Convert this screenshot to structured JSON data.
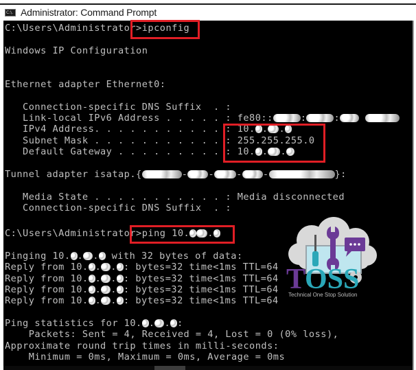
{
  "window": {
    "title": "Administrator: Command Prompt",
    "icon": "cmd-icon",
    "icon_text": "C:\\."
  },
  "console": {
    "lines": {
      "l01": {
        "prefix": "C:\\Users\\Administrator>",
        "command": "ipconfig"
      },
      "l02": "Windows IP Configuration",
      "l03": "Ethernet adapter Ethernet0:",
      "l04": "   Connection-specific DNS Suffix  . :",
      "l05": {
        "label": "   Link-local IPv6 Address . . . . . : ",
        "value": "fe80::",
        "redacted": true
      },
      "l06": {
        "label": "   IPv4 Address. . . . . . . . . . . : ",
        "value": "10.",
        "redacted": true
      },
      "l07": {
        "label": "   Subnet Mask . . . . . . . . . . . : ",
        "value": "255.255.255.0"
      },
      "l08": {
        "label": "   Default Gateway . . . . . . . . . : ",
        "value": "10.",
        "redacted": true
      },
      "l09": {
        "prefix": "Tunnel adapter isatap.{",
        "suffix": "}:",
        "redacted": true
      },
      "l10": {
        "label": "   Media State . . . . . . . . . . . : ",
        "value": "Media disconnected"
      },
      "l11": "   Connection-specific DNS Suffix  . :",
      "l12": {
        "prefix": "C:\\Users\\Administrator>",
        "command": "ping 10.",
        "redacted": true
      },
      "l13": {
        "prefix": "Pinging 10.",
        "suffix": " with 32 bytes of data:",
        "redacted": true
      },
      "replies": [
        {
          "prefix": "Reply from 10.",
          "suffix": ": bytes=32 time<1ms TTL=64"
        },
        {
          "prefix": "Reply from 10.",
          "suffix": ": bytes=32 time<1ms TTL=64"
        },
        {
          "prefix": "Reply from 10.",
          "suffix": ": bytes=32 time<1ms TTL=64"
        },
        {
          "prefix": "Reply from 10.",
          "suffix": ": bytes=32 time<1ms TTL=64"
        }
      ],
      "l18": {
        "prefix": "Ping statistics for 10.",
        "suffix": ":",
        "redacted": true
      },
      "l19": "    Packets: Sent = 4, Received = 4, Lost = 0 (0% loss),",
      "l20": "Approximate round trip times in milli-seconds:",
      "l21": "    Minimum = 0ms, Maximum = 0ms, Average = 0ms"
    },
    "colors": {
      "background": "#000000",
      "text": "#c0c0c0",
      "highlight": "#e01e25"
    }
  },
  "logo": {
    "name": "TOSS",
    "tagline": "Technical One Stop Solution",
    "colors": {
      "purple": "#6b3a96",
      "teal": "#2aa7b8",
      "cloud": "#d9d9d9",
      "screen": "#bfe6ef"
    }
  }
}
